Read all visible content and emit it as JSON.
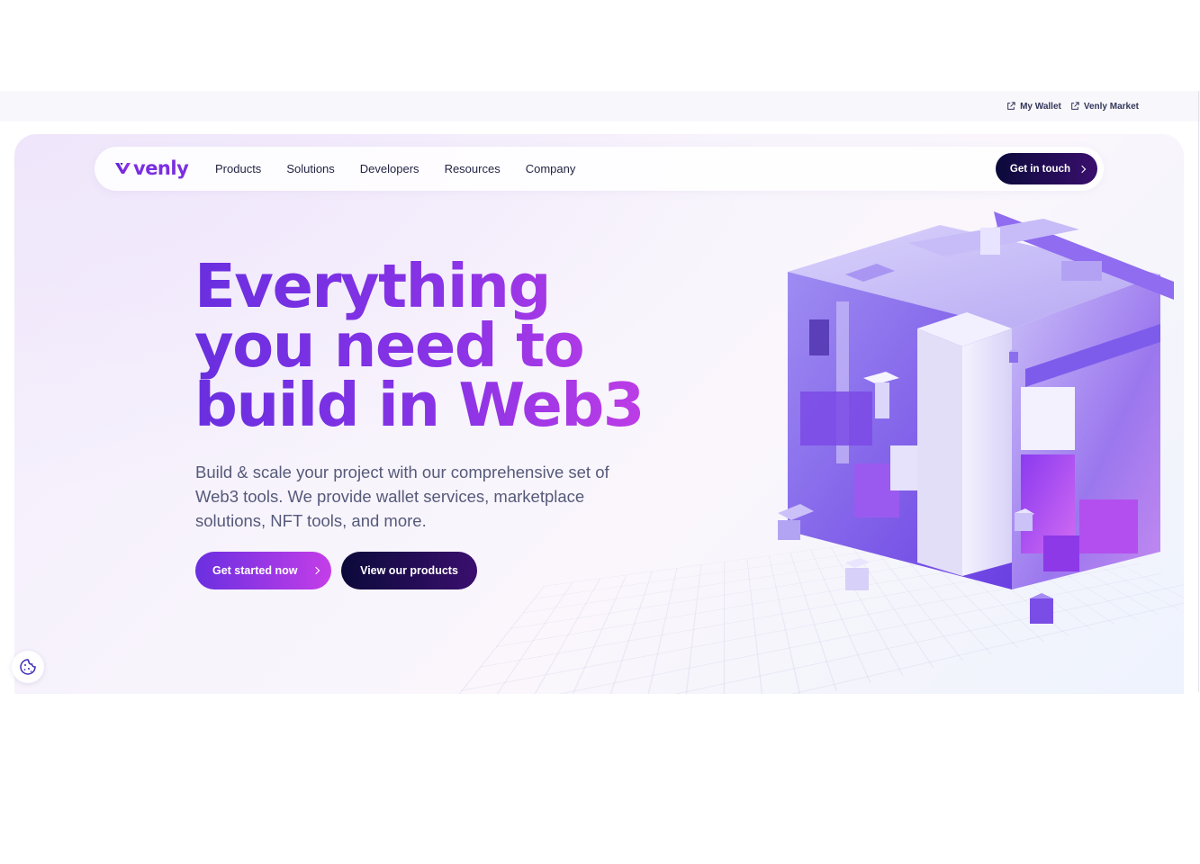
{
  "topbar": {
    "links": [
      {
        "label": "My Wallet",
        "icon": "external-link-icon"
      },
      {
        "label": "Venly Market",
        "icon": "external-link-icon"
      }
    ]
  },
  "nav": {
    "logo_text": "venly",
    "items": [
      "Products",
      "Solutions",
      "Developers",
      "Resources",
      "Company"
    ],
    "cta_label": "Get in touch"
  },
  "hero": {
    "headline_lines": [
      "Everything",
      "you need to",
      "build in Web3"
    ],
    "subtitle": "Build & scale your project with our comprehensive set of Web3 tools. We provide wallet services, marketplace solutions, NFT tools, and more.",
    "primary_button": "Get started now",
    "secondary_button": "View our products",
    "art_icon": "isometric-cube-illustration"
  },
  "cookie": {
    "icon": "cookie-icon"
  },
  "colors": {
    "brand_purple": "#7a2fe0",
    "gradient_end": "#c43ee8",
    "navy": "#0b0a3a",
    "text_dark": "#1f2340",
    "text_muted": "#555a7a"
  }
}
